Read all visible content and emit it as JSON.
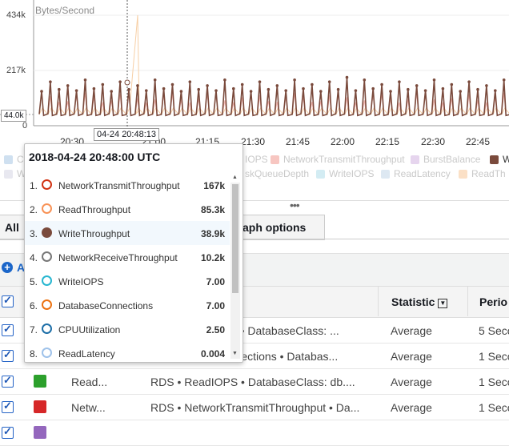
{
  "chart": {
    "unit": "Bytes/Second",
    "y_ticks": [
      "434k",
      "217k",
      "0"
    ],
    "y_marker": "44.0k",
    "x_ticks": [
      "20:30",
      "21:00",
      "21:15",
      "21:30",
      "21:45",
      "22:00",
      "22:15",
      "22:30",
      "22:45"
    ],
    "x_ticks_partial": [
      "20:45"
    ],
    "cursor_time": "04-24 20:48:13"
  },
  "chart_data": {
    "type": "line",
    "ylabel": "Bytes/Second",
    "ylim": [
      0,
      434000
    ],
    "series": [
      {
        "name": "WriteThroughput",
        "color": "#7a4a3c",
        "baseline": 44000,
        "peak": 190000
      },
      {
        "name": "NetworkTransmitThroughput",
        "color": "#f3b2ab",
        "baseline": 44000,
        "peak": 130000
      },
      {
        "name": "ReadThroughput",
        "color": "#f7cfa5",
        "baseline": 44000,
        "peak": 434000
      }
    ]
  },
  "legend": [
    {
      "label": "C",
      "color": "#cfe0f0"
    },
    {
      "label": "IOPS",
      "color": "#ffffff"
    },
    {
      "label": "NetworkTransmitThroughput",
      "color": "#f7c6c1"
    },
    {
      "label": "BurstBalance",
      "color": "#e6d5ee"
    },
    {
      "label": "W",
      "color": "#7a4a3c"
    },
    {
      "label": "W",
      "color": "#e8e8f0"
    },
    {
      "label": "skQueueDepth",
      "color": "#ffffff"
    },
    {
      "label": "WriteIOPS",
      "color": "#d3ecf3"
    },
    {
      "label": "ReadLatency",
      "color": "#dde8f2"
    },
    {
      "label": "ReadTh",
      "color": "#fbe0c6"
    }
  ],
  "tabs": {
    "all": "All",
    "graph_options": "aph options"
  },
  "add_row": {
    "label": "A"
  },
  "table": {
    "headers": {
      "statistic": "Statistic",
      "period": "Perio"
    },
    "rows": [
      {
        "color": "#ffffff",
        "label": "",
        "details": "ion • DatabaseClass: ...",
        "statistic": "Average",
        "period": "5 Seco"
      },
      {
        "color": "#ffffff",
        "label": "",
        "details": "onnections • Databas...",
        "statistic": "Average",
        "period": "1 Seco"
      },
      {
        "color": "#2ca02c",
        "label": "Read...",
        "details": "RDS • ReadIOPS • DatabaseClass: db....",
        "statistic": "Average",
        "period": "1 Seco"
      },
      {
        "color": "#d62728",
        "label": "Netw...",
        "details": "RDS • NetworkTransmitThroughput • Da...",
        "statistic": "Average",
        "period": "1 Seco"
      },
      {
        "color": "#9467bd",
        "label": "",
        "details": "",
        "statistic": "",
        "period": ""
      }
    ]
  },
  "tooltip": {
    "title": "2018-04-24 20:48:00 UTC",
    "items": [
      {
        "num": "1.",
        "name": "NetworkTransmitThroughput",
        "value": "167k",
        "color": "#d13212",
        "filled": false
      },
      {
        "num": "2.",
        "name": "ReadThroughput",
        "value": "85.3k",
        "color": "#f89256",
        "filled": false
      },
      {
        "num": "3.",
        "name": "WriteThroughput",
        "value": "38.9k",
        "color": "#7a4a3c",
        "filled": true
      },
      {
        "num": "4.",
        "name": "NetworkReceiveThroughput",
        "value": "10.2k",
        "color": "#777777",
        "filled": false
      },
      {
        "num": "5.",
        "name": "WriteIOPS",
        "value": "7.00",
        "color": "#27b6d0",
        "filled": false
      },
      {
        "num": "6.",
        "name": "DatabaseConnections",
        "value": "7.00",
        "color": "#ec7211",
        "filled": false
      },
      {
        "num": "7.",
        "name": "CPUUtilization",
        "value": "2.50",
        "color": "#1e6fa8",
        "filled": false
      },
      {
        "num": "8.",
        "name": "ReadLatency",
        "value": "0.004",
        "color": "#9fc2ea",
        "filled": false
      }
    ]
  }
}
